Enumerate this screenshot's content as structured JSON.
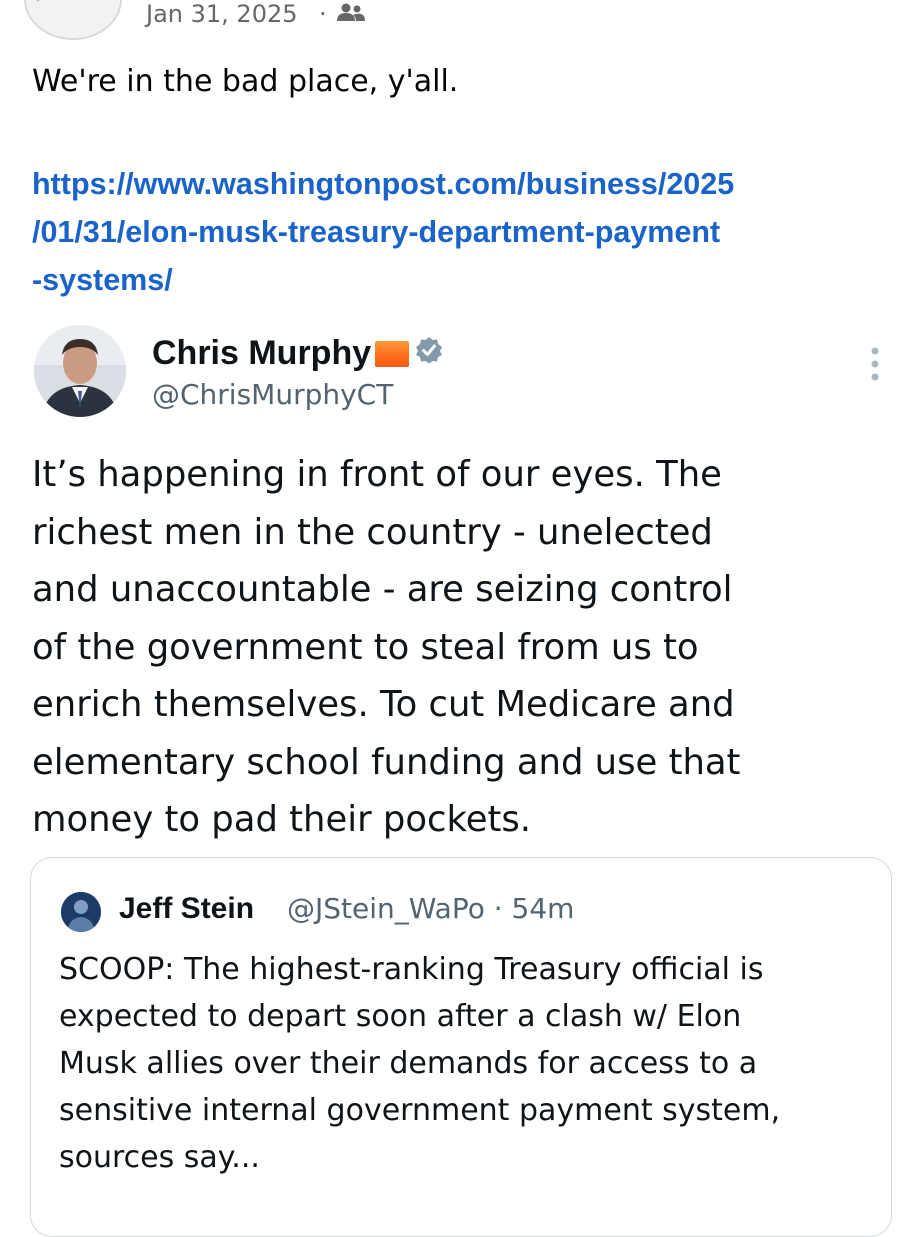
{
  "post": {
    "date": "Jan 31, 2025",
    "separator": "·",
    "audience_icon": "friends-icon",
    "text": "We're in the bad place, y'all.",
    "link_lines": [
      "https://www.washingtonpost.com/business/2025",
      "/01/31/elon-musk-treasury-department-payment",
      "-systems/"
    ]
  },
  "tweet": {
    "author_name": "Chris Murphy",
    "handle": "@ChrisMurphyCT",
    "verified_icon": "verified-badge-icon",
    "more_icon": "more-vertical-icon",
    "text_lines": [
      "It’s happening in front of our eyes. The",
      "richest men in the country - unelected",
      "and unaccountable - are seizing control",
      "of the government to steal from us to",
      "enrich themselves. To cut Medicare and",
      "elementary school funding and use that",
      "money to pad their pockets."
    ]
  },
  "quote": {
    "author_name": "Jeff Stein",
    "meta": "@JStein_WaPo · 54m",
    "text_lines": [
      "SCOOP: The highest-ranking Treasury official is",
      "expected to depart soon after a clash w/ Elon",
      "Musk allies over their demands for access to a",
      "sensitive internal government payment system,",
      "sources say..."
    ]
  },
  "colors": {
    "link": "#1a63c8",
    "secondary_text": "#65676b",
    "tweet_handle": "#536471",
    "verified": "#829aab",
    "flag": "#ff7a1f"
  }
}
